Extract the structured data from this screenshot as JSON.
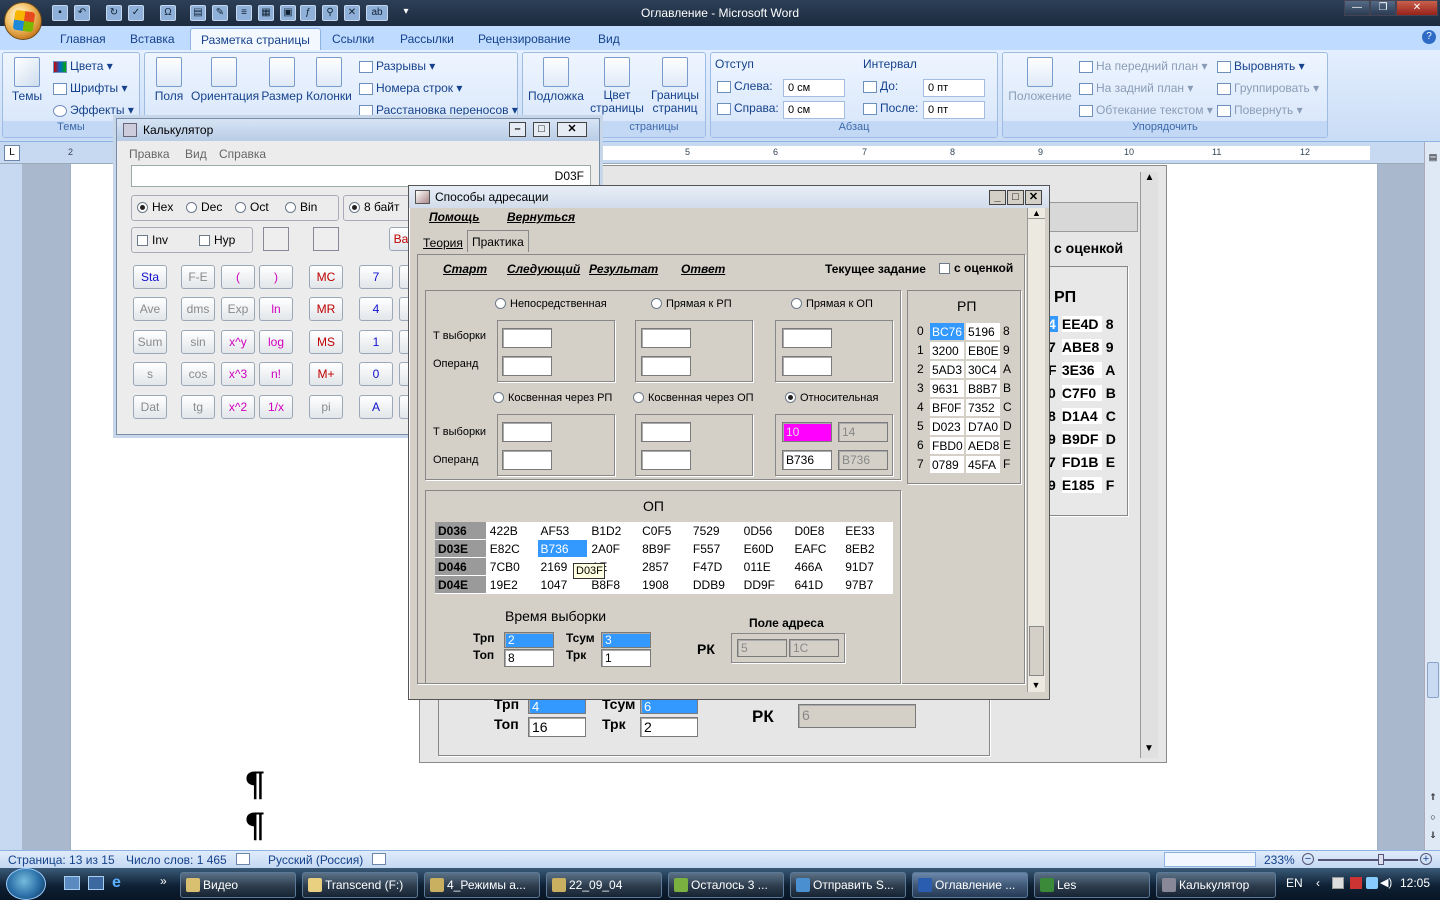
{
  "word": {
    "title": "Оглавление - Microsoft Word",
    "tabs": [
      "Главная",
      "Вставка",
      "Разметка страницы",
      "Ссылки",
      "Рассылки",
      "Рецензирование",
      "Вид"
    ],
    "active_tab": "Разметка страницы",
    "groups": {
      "themes": {
        "label": "Темы",
        "big": "Темы",
        "colors": "Цвета",
        "fonts": "Шрифты",
        "effects": "Эффекты"
      },
      "page_setup": {
        "fields": "Поля",
        "orientation": "Ориентация",
        "size": "Размер",
        "columns": "Колонки",
        "breaks": "Разрывы",
        "line_numbers": "Номера строк",
        "hyphenation": "Расстановка переносов"
      },
      "background": {
        "label": "страницы",
        "watermark": "Подложка",
        "color": "Цвет страницы",
        "borders": "Границы страниц"
      },
      "paragraph": {
        "label": "Абзац",
        "indent": "Отступ",
        "left": "Слева:",
        "right": "Справа:",
        "left_val": "0 см",
        "right_val": "0 см",
        "spacing": "Интервал",
        "before": "До:",
        "after": "После:",
        "before_val": "0 пт",
        "after_val": "0 пт"
      },
      "arrange": {
        "label": "Упорядочить",
        "position": "Положение",
        "front": "На передний план",
        "back": "На задний план",
        "wrap": "Обтекание текстом",
        "align": "Выровнять",
        "group": "Группировать",
        "rotate": "Повернуть"
      }
    },
    "ruler_marks": [
      "2",
      "5",
      "6",
      "7",
      "8",
      "9",
      "10",
      "11",
      "12"
    ],
    "status": {
      "page": "Страница: 13 из 15",
      "words": "Число слов: 1 465",
      "lang": "Русский (Россия)",
      "zoom": "233%"
    },
    "pilcrow": "¶"
  },
  "embedded": {
    "grade_label": "с оценкой",
    "rp_title": "РП",
    "rp_rows": [
      [
        "4",
        "EE4D",
        "8"
      ],
      [
        "7",
        "ABE8",
        "9"
      ],
      [
        "F",
        "3E36",
        "A"
      ],
      [
        "0",
        "C7F0",
        "B"
      ],
      [
        "8",
        "D1A4",
        "C"
      ],
      [
        "9",
        "B9DF",
        "D"
      ],
      [
        "7",
        "FD1B",
        "E"
      ],
      [
        "9",
        "E185",
        "F"
      ]
    ],
    "trp_label": "Трп",
    "trp": "4",
    "top_label": "Топ",
    "top": "16",
    "tsum_label": "Тсум",
    "tsum": "6",
    "trk_label": "Трк",
    "trk": "2",
    "pk_label": "РК",
    "pk": "6"
  },
  "calc": {
    "title": "Калькулятор",
    "menu": [
      "Правка",
      "Вид",
      "Справка"
    ],
    "display": "D03F",
    "bases": [
      "Hex",
      "Dec",
      "Oct",
      "Bin"
    ],
    "selected_base": "Hex",
    "word_size": "8 байт",
    "inv": "Inv",
    "hyp": "Hyp",
    "backspace_partial": "Ba",
    "rows": [
      [
        {
          "t": "Sta",
          "c": "blue"
        },
        {
          "t": "F-E",
          "c": "gray"
        },
        {
          "t": "(",
          "c": "mag"
        },
        {
          "t": ")",
          "c": "mag"
        },
        {
          "t": "MC",
          "c": "red"
        },
        {
          "t": "7",
          "c": "blue"
        }
      ],
      [
        {
          "t": "Ave",
          "c": "gray"
        },
        {
          "t": "dms",
          "c": "gray"
        },
        {
          "t": "Exp",
          "c": "gray"
        },
        {
          "t": "ln",
          "c": "mag"
        },
        {
          "t": "MR",
          "c": "red"
        },
        {
          "t": "4",
          "c": "blue"
        }
      ],
      [
        {
          "t": "Sum",
          "c": "gray"
        },
        {
          "t": "sin",
          "c": "gray"
        },
        {
          "t": "x^y",
          "c": "mag"
        },
        {
          "t": "log",
          "c": "mag"
        },
        {
          "t": "MS",
          "c": "red"
        },
        {
          "t": "1",
          "c": "blue"
        }
      ],
      [
        {
          "t": "s",
          "c": "gray"
        },
        {
          "t": "cos",
          "c": "gray"
        },
        {
          "t": "x^3",
          "c": "mag"
        },
        {
          "t": "n!",
          "c": "mag"
        },
        {
          "t": "M+",
          "c": "red"
        },
        {
          "t": "0",
          "c": "blue"
        }
      ],
      [
        {
          "t": "Dat",
          "c": "gray"
        },
        {
          "t": "tg",
          "c": "gray"
        },
        {
          "t": "x^2",
          "c": "mag"
        },
        {
          "t": "1/x",
          "c": "mag"
        },
        {
          "t": "pi",
          "c": "gray"
        },
        {
          "t": "A",
          "c": "blue"
        }
      ]
    ]
  },
  "dlg": {
    "title": "Способы адресации",
    "menu": [
      "Помощь",
      "Вернуться"
    ],
    "tabs": [
      "Теория",
      "Практика"
    ],
    "actions": [
      "Старт",
      "Следующий",
      "Результат",
      "Ответ"
    ],
    "current_task": "Текущее задание",
    "with_grade": "с оценкой",
    "modes_top": [
      "Непосредственная",
      "Прямая к РП",
      "Прямая к ОП"
    ],
    "modes_bottom": [
      "Косвенная через РП",
      "Косвенная через ОП",
      "Относительная"
    ],
    "selected_mode": "Относительная",
    "t_fetch": "Т выборки",
    "operand": "Операнд",
    "rel_fields": {
      "a": "10",
      "b": "14",
      "c": "B736",
      "d": "B736"
    },
    "rp": {
      "title": "РП",
      "rows": [
        [
          "0",
          "BC76",
          "5196",
          "8"
        ],
        [
          "1",
          "3200",
          "EB0E",
          "9"
        ],
        [
          "2",
          "5AD3",
          "30C4",
          "A"
        ],
        [
          "3",
          "9631",
          "B8B7",
          "B"
        ],
        [
          "4",
          "BF0F",
          "7352",
          "C"
        ],
        [
          "5",
          "D023",
          "D7A0",
          "D"
        ],
        [
          "6",
          "FBD0",
          "AED8",
          "E"
        ],
        [
          "7",
          "0789",
          "45FA",
          "F"
        ]
      ]
    },
    "op": {
      "title": "ОП",
      "rows": [
        [
          "D036",
          "422B",
          "AF53",
          "B1D2",
          "C0F5",
          "7529",
          "0D56",
          "D0E8",
          "EE33"
        ],
        [
          "D03E",
          "E82C",
          "B736",
          "2A0F",
          "8B9F",
          "F557",
          "E60D",
          "EAFC",
          "8EB2"
        ],
        [
          "D046",
          "7CB0",
          "2169",
          "AE",
          "2857",
          "F47D",
          "011E",
          "466A",
          "91D7"
        ],
        [
          "D04E",
          "19E2",
          "1047",
          "B8F8",
          "1908",
          "DDB9",
          "DD9F",
          "641D",
          "97B7"
        ]
      ],
      "tooltip": "D03F"
    },
    "time_title": "Время выборки",
    "trp_label": "Трп",
    "trp": "2",
    "top_label": "Топ",
    "top": "8",
    "tsum_label": "Тсум",
    "tsum": "3",
    "trk_label": "Трк",
    "trk": "1",
    "addr_title": "Поле адреса",
    "pk_label": "РК",
    "pk1": "5",
    "pk2": "1C"
  },
  "taskbar": {
    "items": [
      "Видео",
      "Transcend (F:)",
      "4_Режимы а...",
      "22_09_04",
      "Осталось 3 ...",
      "Отправить S...",
      "Оглавление ...",
      "Les",
      "Калькулятор"
    ],
    "lang": "EN",
    "time": "12:05"
  }
}
